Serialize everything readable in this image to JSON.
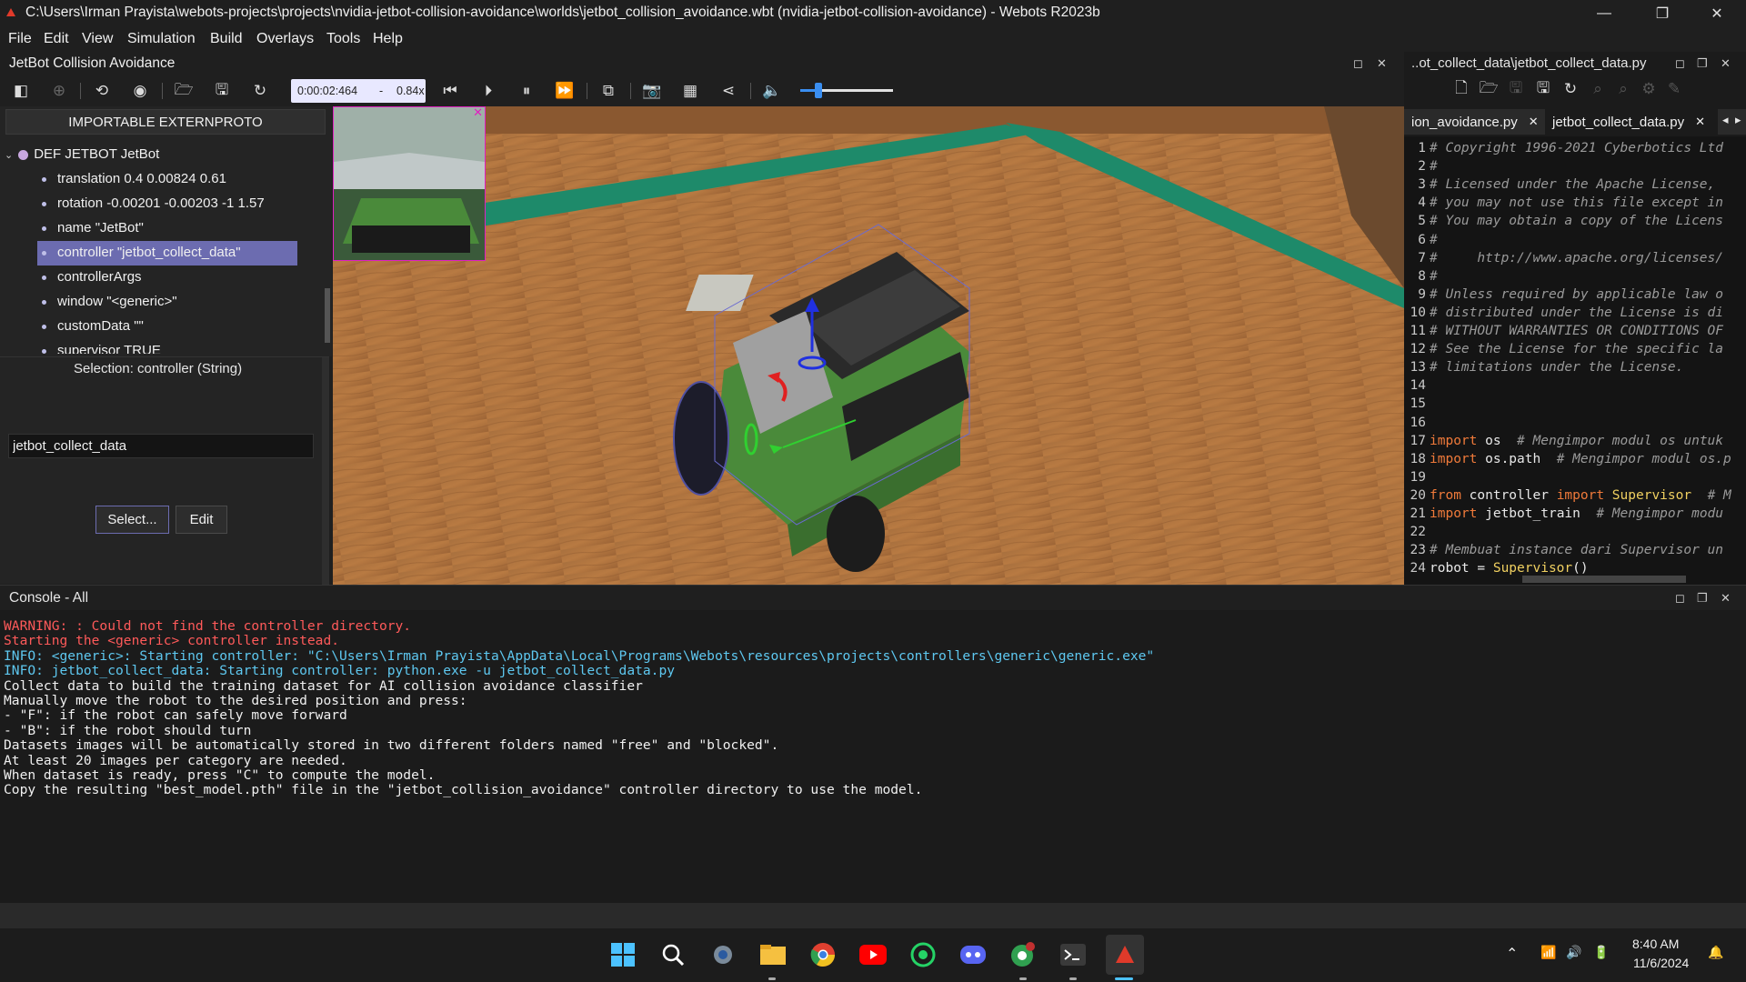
{
  "window": {
    "title": "C:\\Users\\Irman Prayista\\webots-projects\\projects\\nvidia-jetbot-collision-avoidance\\worlds\\jetbot_collision_avoidance.wbt (nvidia-jetbot-collision-avoidance) - Webots R2023b",
    "minimize": "—",
    "maximize": "❐",
    "close": "✕"
  },
  "menu": [
    "File",
    "Edit",
    "View",
    "Simulation",
    "Build",
    "Overlays",
    "Tools",
    "Help"
  ],
  "left_dock": {
    "title": "JetBot Collision Avoidance"
  },
  "toolbar": {
    "time": "0:00:02:464",
    "speed_sep": "-",
    "speed": "0.84x",
    "volume_level": 0.2
  },
  "scene_tree": {
    "import_button": "IMPORTABLE EXTERNPROTO",
    "root": "DEF JETBOT JetBot",
    "fields": [
      "translation 0.4 0.00824 0.61",
      "rotation -0.00201 -0.00203 -1 1.57",
      "name \"JetBot\"",
      "controller \"jetbot_collect_data\"",
      "controllerArgs",
      "window \"<generic>\"",
      "customData \"\"",
      "supervisor TRUE"
    ],
    "selected_index": 3
  },
  "field_editor": {
    "selection_label": "Selection: controller (String)",
    "value": "jetbot_collect_data",
    "select_button": "Select...",
    "edit_button": "Edit"
  },
  "editor": {
    "dock_title": "..ot_collect_data\\jetbot_collect_data.py",
    "tabs": [
      {
        "label": "ion_avoidance.py",
        "close": "✕"
      },
      {
        "label": "jetbot_collect_data.py",
        "close": "✕"
      }
    ],
    "lines": [
      {
        "n": "1",
        "parts": [
          {
            "t": "# Copyright 1996-2021 Cyberbotics Ltd",
            "c": "cm"
          }
        ]
      },
      {
        "n": "2",
        "parts": [
          {
            "t": "#",
            "c": "cm"
          }
        ]
      },
      {
        "n": "3",
        "parts": [
          {
            "t": "# Licensed under the Apache License,",
            "c": "cm"
          }
        ]
      },
      {
        "n": "4",
        "parts": [
          {
            "t": "# you may not use this file except in",
            "c": "cm"
          }
        ]
      },
      {
        "n": "5",
        "parts": [
          {
            "t": "# You may obtain a copy of the Licens",
            "c": "cm"
          }
        ]
      },
      {
        "n": "6",
        "parts": [
          {
            "t": "#",
            "c": "cm"
          }
        ]
      },
      {
        "n": "7",
        "parts": [
          {
            "t": "#     http://www.apache.org/licenses/",
            "c": "cm"
          }
        ]
      },
      {
        "n": "8",
        "parts": [
          {
            "t": "#",
            "c": "cm"
          }
        ]
      },
      {
        "n": "9",
        "parts": [
          {
            "t": "# Unless required by applicable law o",
            "c": "cm"
          }
        ]
      },
      {
        "n": "10",
        "parts": [
          {
            "t": "# distributed under the License is di",
            "c": "cm"
          }
        ]
      },
      {
        "n": "11",
        "parts": [
          {
            "t": "# WITHOUT WARRANTIES OR CONDITIONS OF",
            "c": "cm"
          }
        ]
      },
      {
        "n": "12",
        "parts": [
          {
            "t": "# See the License for the specific la",
            "c": "cm"
          }
        ]
      },
      {
        "n": "13",
        "parts": [
          {
            "t": "# limitations under the License.",
            "c": "cm"
          }
        ]
      },
      {
        "n": "14",
        "parts": []
      },
      {
        "n": "15",
        "parts": []
      },
      {
        "n": "16",
        "parts": []
      },
      {
        "n": "17",
        "parts": [
          {
            "t": "import",
            "c": "kw"
          },
          {
            "t": " os  ",
            "c": ""
          },
          {
            "t": "# Mengimpor modul os untuk",
            "c": "cm"
          }
        ]
      },
      {
        "n": "18",
        "parts": [
          {
            "t": "import",
            "c": "kw"
          },
          {
            "t": " os.path  ",
            "c": ""
          },
          {
            "t": "# Mengimpor modul os.p",
            "c": "cm"
          }
        ]
      },
      {
        "n": "19",
        "parts": []
      },
      {
        "n": "20",
        "parts": [
          {
            "t": "from",
            "c": "kw"
          },
          {
            "t": " controller ",
            "c": ""
          },
          {
            "t": "import",
            "c": "kw"
          },
          {
            "t": " Supervisor",
            "c": "cls"
          },
          {
            "t": "  # M",
            "c": "cm"
          }
        ]
      },
      {
        "n": "21",
        "parts": [
          {
            "t": "import",
            "c": "kw"
          },
          {
            "t": " jetbot_train  ",
            "c": ""
          },
          {
            "t": "# Mengimpor modu",
            "c": "cm"
          }
        ]
      },
      {
        "n": "22",
        "parts": []
      },
      {
        "n": "23",
        "parts": [
          {
            "t": "# Membuat instance dari Supervisor un",
            "c": "cm"
          }
        ]
      },
      {
        "n": "24",
        "parts": [
          {
            "t": "robot = ",
            "c": ""
          },
          {
            "t": "Supervisor",
            "c": "cls"
          },
          {
            "t": "()",
            "c": ""
          }
        ]
      }
    ]
  },
  "console": {
    "title": "Console - All",
    "lines": [
      {
        "t": "WARNING: : Could not find the controller directory.",
        "c": "warn"
      },
      {
        "t": "Starting the <generic> controller instead.",
        "c": "warn"
      },
      {
        "t": "INFO: <generic>: Starting controller: \"C:\\Users\\Irman Prayista\\AppData\\Local\\Programs\\Webots\\resources\\projects\\controllers\\generic\\generic.exe\"",
        "c": "info"
      },
      {
        "t": "INFO: jetbot_collect_data: Starting controller: python.exe -u jetbot_collect_data.py",
        "c": "info"
      },
      {
        "t": "Collect data to build the training dataset for AI collision avoidance classifier",
        "c": ""
      },
      {
        "t": "Manually move the robot to the desired position and press:",
        "c": ""
      },
      {
        "t": "- \"F\": if the robot can safely move forward",
        "c": ""
      },
      {
        "t": "- \"B\": if the robot should turn",
        "c": ""
      },
      {
        "t": "Datasets images will be automatically stored in two different folders named \"free\" and \"blocked\".",
        "c": ""
      },
      {
        "t": "At least 20 images per category are needed.",
        "c": ""
      },
      {
        "t": "When dataset is ready, press \"C\" to compute the model.",
        "c": ""
      },
      {
        "t": "Copy the resulting \"best_model.pth\" file in the \"jetbot_collision_avoidance\" controller directory to use the model.",
        "c": ""
      }
    ]
  },
  "taskbar": {
    "time": "8:40 AM",
    "date": "11/6/2024",
    "apps": [
      "start",
      "search",
      "settings",
      "file-explorer",
      "chrome",
      "youtube",
      "whatsapp",
      "discord",
      "chrome-profile",
      "terminal",
      "webots"
    ]
  },
  "colors": {
    "accent": "#6c6cb0",
    "warning": "#ff5a5a",
    "info": "#5ec8f0",
    "comment": "#9a9a9a",
    "keyword": "#f07a3a",
    "class": "#f0d060"
  }
}
